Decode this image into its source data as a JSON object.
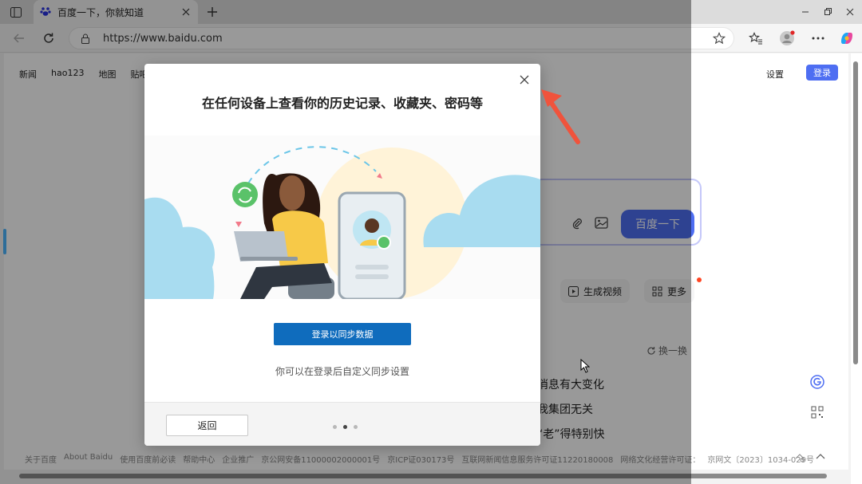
{
  "browser": {
    "tab_title": "百度一下，你就知道",
    "url": "https://www.baidu.com"
  },
  "page": {
    "topnav": [
      "新闻",
      "hao123",
      "地图",
      "贴吧"
    ],
    "settings": "设置",
    "login": "登录",
    "search_submit": "百度一下",
    "chips": [
      "生成视频",
      "更多"
    ],
    "refresh": "换一换",
    "hot_items": [
      "消息有大变化",
      "我集团无关",
      "“老”得特别快"
    ],
    "footer": [
      "关于百度",
      "About Baidu",
      "使用百度前必读",
      "帮助中心",
      "企业推广",
      "京公网安备11000002000001号",
      "京ICP证030173号",
      "互联网新闻信息服务许可证11220180008",
      "网络文化经营许可证：",
      "京网文〔2023〕1034-029号"
    ]
  },
  "modal": {
    "title": "在任何设备上查看你的历史记录、收藏夹、密码等",
    "cta": "登录以同步数据",
    "subtext": "你可以在登录后自定义同步设置",
    "back": "返回",
    "pages_total": 3,
    "page_current": 2
  },
  "colors": {
    "baidu_blue": "#4e6ef2",
    "edge_blue": "#0f6cbd",
    "annotation_red": "#f0533c"
  }
}
